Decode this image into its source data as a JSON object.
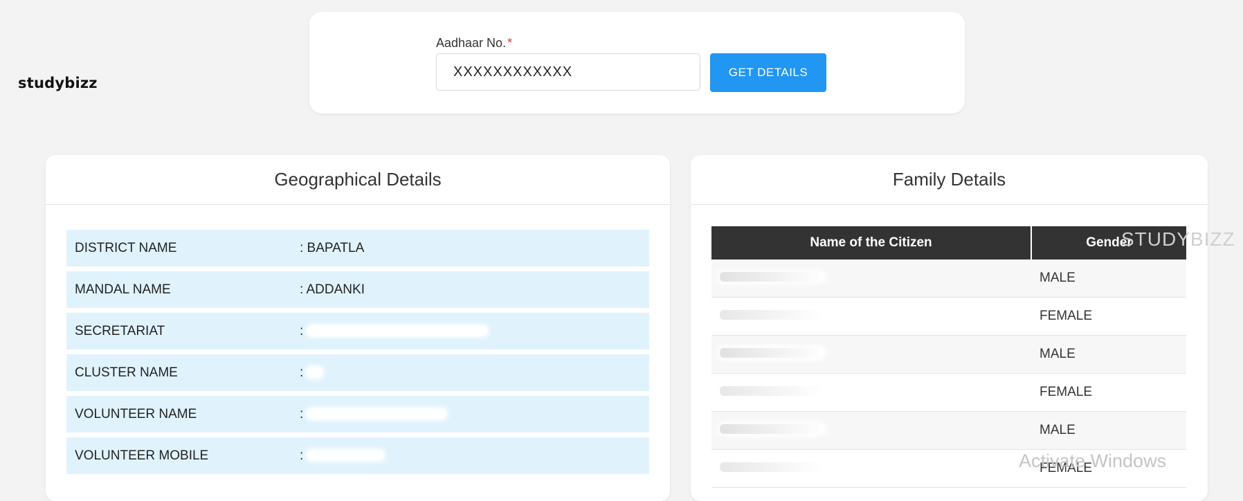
{
  "watermark_brand": "studybizz",
  "watermark_overlay": "STUDYBIZZ",
  "os_notice": "Activate Windows",
  "search": {
    "label": "Aadhaar No.",
    "required_mark": "*",
    "value": "XXXXXXXXXXXX",
    "button_label": "GET DETAILS"
  },
  "geo": {
    "title": "Geographical Details",
    "rows": [
      {
        "key": "DISTRICT NAME",
        "value": ": BAPATLA"
      },
      {
        "key": "MANDAL NAME",
        "value": ": ADDANKI"
      },
      {
        "key": "SECRETARIAT",
        "value": ": "
      },
      {
        "key": "CLUSTER NAME",
        "value": ": "
      },
      {
        "key": "VOLUNTEER NAME",
        "value": ": "
      },
      {
        "key": "VOLUNTEER MOBILE",
        "value": ": "
      }
    ]
  },
  "family": {
    "title": "Family Details",
    "columns": [
      "Name of the Citizen",
      "Gender"
    ],
    "rows": [
      {
        "gender": "MALE"
      },
      {
        "gender": "FEMALE"
      },
      {
        "gender": "MALE"
      },
      {
        "gender": "FEMALE"
      },
      {
        "gender": "MALE"
      },
      {
        "gender": "FEMALE"
      }
    ]
  },
  "colors": {
    "accent": "#2196f3",
    "table_header": "#333333",
    "geo_row_bg": "#e0f3fd"
  }
}
